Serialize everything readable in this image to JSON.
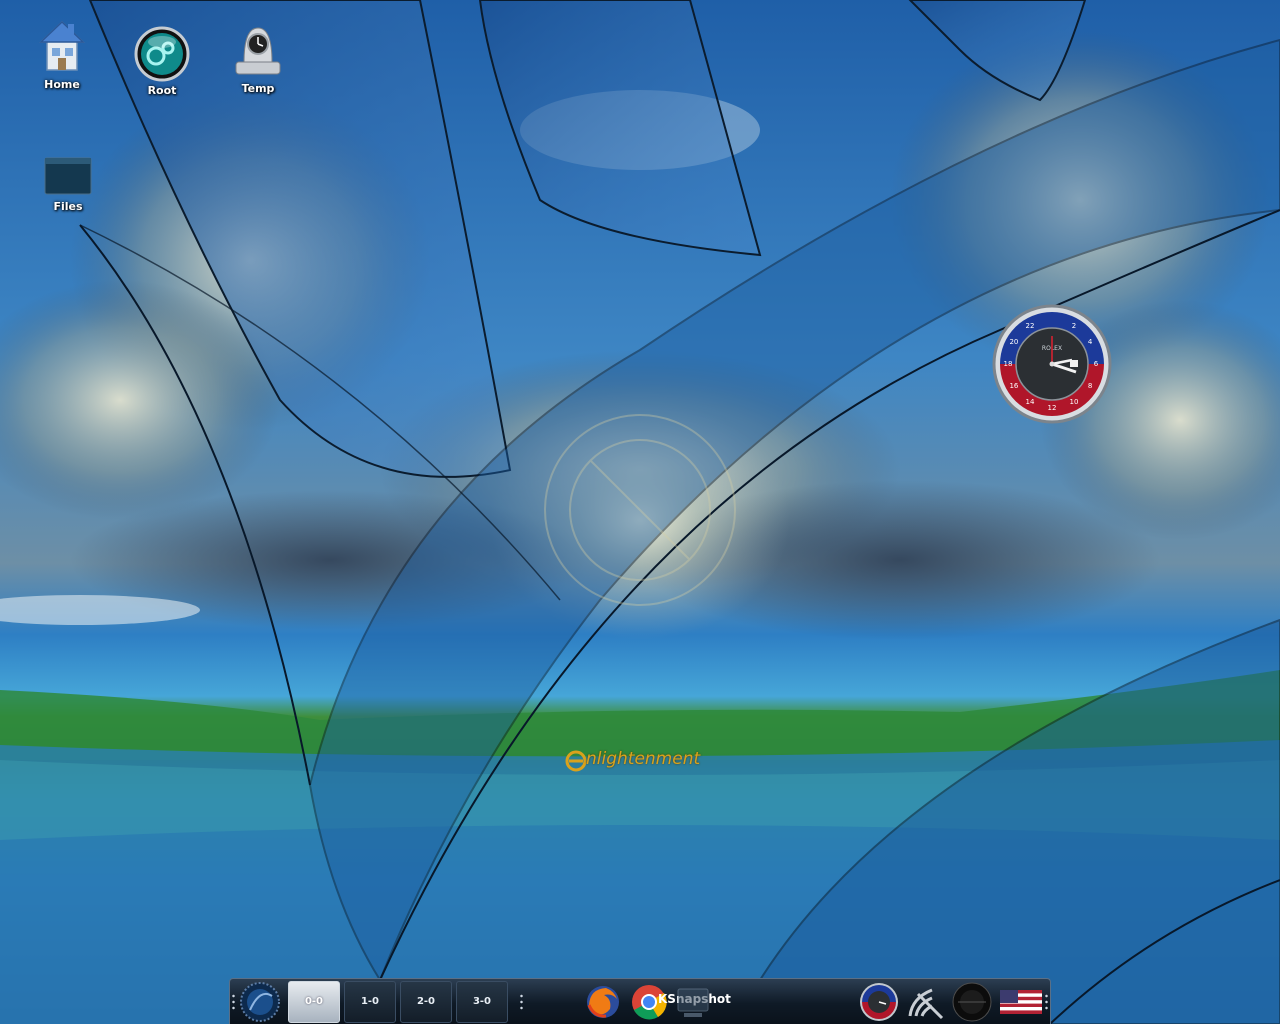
{
  "desktop_icons": [
    {
      "label": "Home",
      "icon": "house-icon"
    },
    {
      "label": "Root",
      "icon": "gear-orb-icon"
    },
    {
      "label": "Temp",
      "icon": "clock-drive-icon"
    },
    {
      "label": "Files",
      "icon": "folder-icon"
    }
  ],
  "wallpaper": {
    "logo_text": "nlightenment"
  },
  "clock_gadget": {
    "brand": "ROLEX",
    "bezel_numbers": [
      "2",
      "4",
      "6",
      "8",
      "10",
      "12",
      "14",
      "16",
      "18",
      "20",
      "22"
    ]
  },
  "shelf": {
    "pager": [
      {
        "label": "0-0",
        "active": true
      },
      {
        "label": "1-0",
        "active": false
      },
      {
        "label": "2-0",
        "active": false
      },
      {
        "label": "3-0",
        "active": false
      }
    ],
    "tasks": [
      {
        "icon": "firefox-icon"
      },
      {
        "icon": "chrome-icon",
        "label": "KSnapshot"
      },
      {
        "icon": "ksnapshot-icon"
      }
    ],
    "tray": [
      {
        "icon": "clock-icon"
      },
      {
        "icon": "network-icon"
      },
      {
        "icon": "mixer-icon"
      },
      {
        "icon": "us-flag-icon"
      }
    ]
  },
  "colors": {
    "sky": "#2f7dc8",
    "grass": "#2f8a3a",
    "water": "#2a78b8",
    "shelf": "#0f1a26",
    "logo": "#d9a21c"
  }
}
